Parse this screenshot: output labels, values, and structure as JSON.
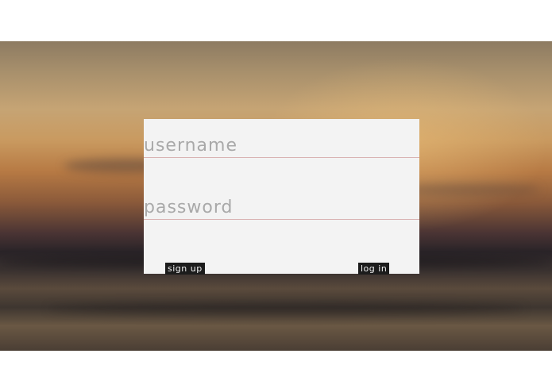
{
  "login_form": {
    "username_placeholder": "username",
    "password_placeholder": "password",
    "signup_label": "sign up",
    "login_label": "log in"
  },
  "colors": {
    "card_background": "#f3f3f3",
    "button_background": "#1c1c1c",
    "field_underline": "#d9b3b3",
    "placeholder_text": "#a9a9a9"
  }
}
